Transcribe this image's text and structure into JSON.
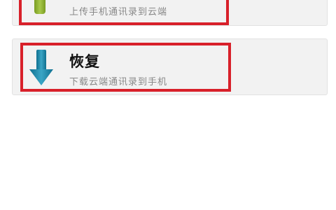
{
  "backup": {
    "subtitle": "上传手机通讯录到云端"
  },
  "restore": {
    "title": "恢复",
    "subtitle": "下载云端通讯录到手机"
  },
  "colors": {
    "highlight": "#d8202a",
    "card_bg": "#f2f2f2",
    "download_arrow": "#1f88a8",
    "upload_icon": "#8fb23a"
  },
  "icons": {
    "backup": "upload-icon",
    "restore": "download-arrow-icon"
  }
}
